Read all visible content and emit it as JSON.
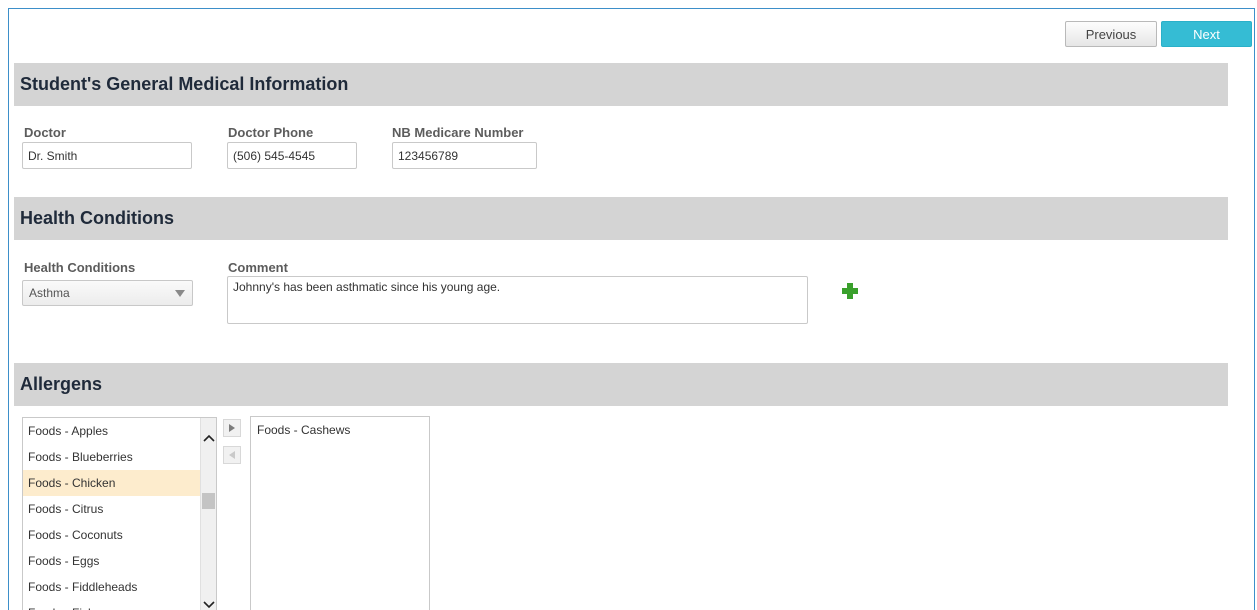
{
  "nav": {
    "previous_label": "Previous",
    "next_label": "Next"
  },
  "general": {
    "title": "Student's General Medical Information",
    "doctor_label": "Doctor",
    "doctor_value": "Dr. Smith",
    "doctor_phone_label": "Doctor Phone",
    "doctor_phone_value": "(506) 545-4545",
    "medicare_label": "NB Medicare Number",
    "medicare_value": "123456789"
  },
  "health": {
    "title": "Health Conditions",
    "conditions_label": "Health Conditions",
    "conditions_selected": "Asthma",
    "comment_label": "Comment",
    "comment_value": "Johnny's has been asthmatic since his young age."
  },
  "allergens": {
    "title": "Allergens",
    "available": [
      "Foods - Apples",
      "Foods - Blueberries",
      "Foods - Chicken",
      "Foods - Citrus",
      "Foods - Coconuts",
      "Foods - Eggs",
      "Foods - Fiddleheads",
      "Foods - Fish"
    ],
    "selected_available_index": 2,
    "chosen": [
      "Foods - Cashews"
    ]
  },
  "icons": {
    "add": "plus-icon",
    "move_right": "arrow-right-icon",
    "move_left": "arrow-left-icon",
    "scroll_up": "chevron-up-icon",
    "scroll_down": "chevron-down-icon"
  },
  "colors": {
    "accent": "#35bcd4",
    "section_bg": "#d4d4d4",
    "selected_row": "#fdeccd",
    "add_icon": "#3aa02c"
  }
}
